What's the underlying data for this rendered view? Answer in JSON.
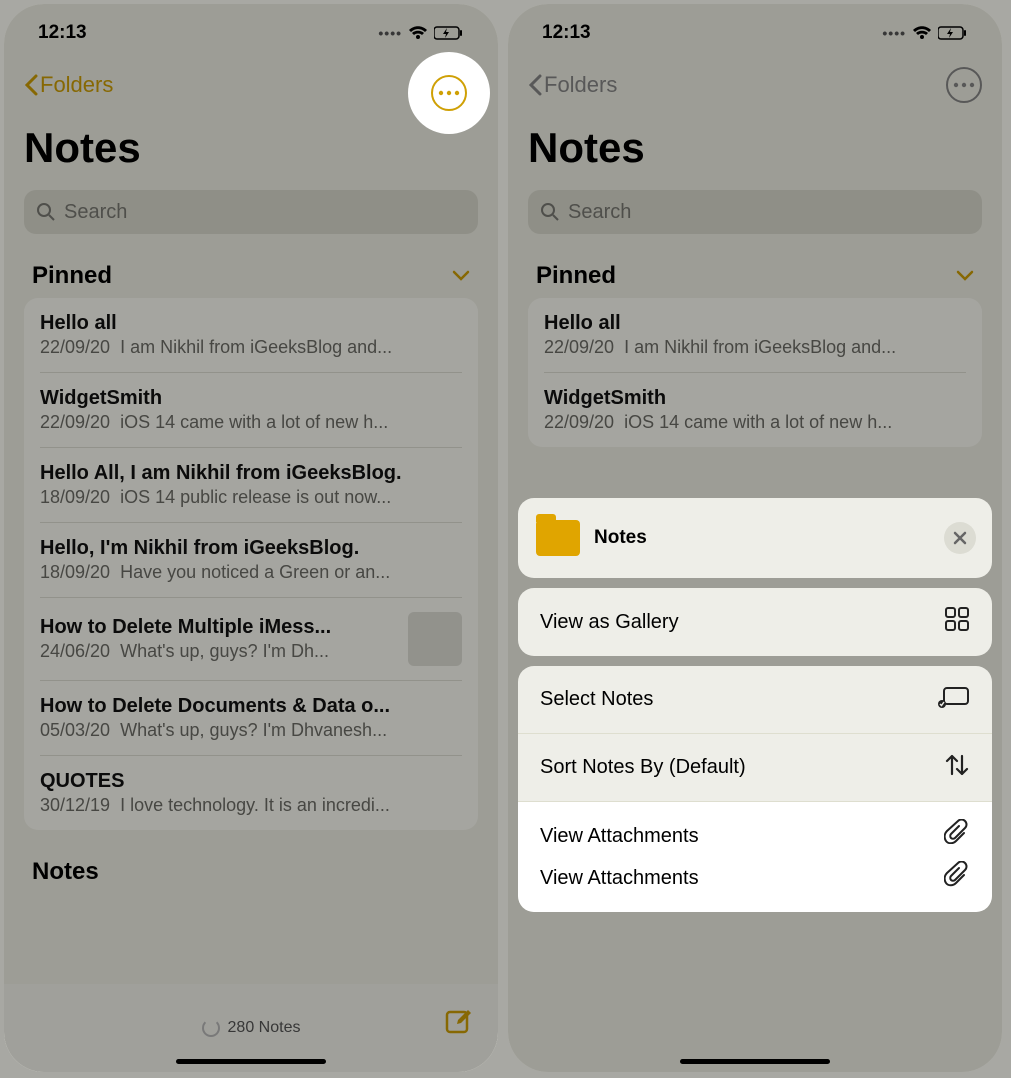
{
  "status": {
    "time": "12:13"
  },
  "nav": {
    "back_label": "Folders"
  },
  "title": "Notes",
  "search": {
    "placeholder": "Search"
  },
  "pinned_section": "Pinned",
  "notes_section": "Notes",
  "pinned": [
    {
      "title": "Hello all",
      "date": "22/09/20",
      "preview": "I am Nikhil from iGeeksBlog and..."
    },
    {
      "title": "WidgetSmith",
      "date": "22/09/20",
      "preview": "iOS 14 came with a lot of new h..."
    },
    {
      "title": "Hello All, I am Nikhil from iGeeksBlog.",
      "date": "18/09/20",
      "preview": "iOS 14 public release is out now..."
    },
    {
      "title": "Hello, I'm Nikhil from iGeeksBlog.",
      "date": "18/09/20",
      "preview": "Have you noticed a Green or an..."
    },
    {
      "title": "How to Delete Multiple iMess...",
      "date": "24/06/20",
      "preview": "What's up, guys? I'm Dh...",
      "thumb": true
    },
    {
      "title": "How to Delete Documents & Data o...",
      "date": "05/03/20",
      "preview": "What's up, guys? I'm Dhvanesh..."
    },
    {
      "title": "QUOTES",
      "date": "30/12/19",
      "preview": "I love technology. It is an incredi..."
    }
  ],
  "footer": {
    "count": "280 Notes"
  },
  "right_pinned": [
    {
      "title": "Hello all",
      "date": "22/09/20",
      "preview": "I am Nikhil from iGeeksBlog and..."
    },
    {
      "title": "WidgetSmith",
      "date": "22/09/20",
      "preview": "iOS 14 came with a lot of new h..."
    }
  ],
  "sheet": {
    "folder_name": "Notes",
    "view_gallery": "View as Gallery",
    "select_notes": "Select Notes",
    "sort_notes": "Sort Notes By (Default)",
    "view_attachments": "View Attachments"
  }
}
